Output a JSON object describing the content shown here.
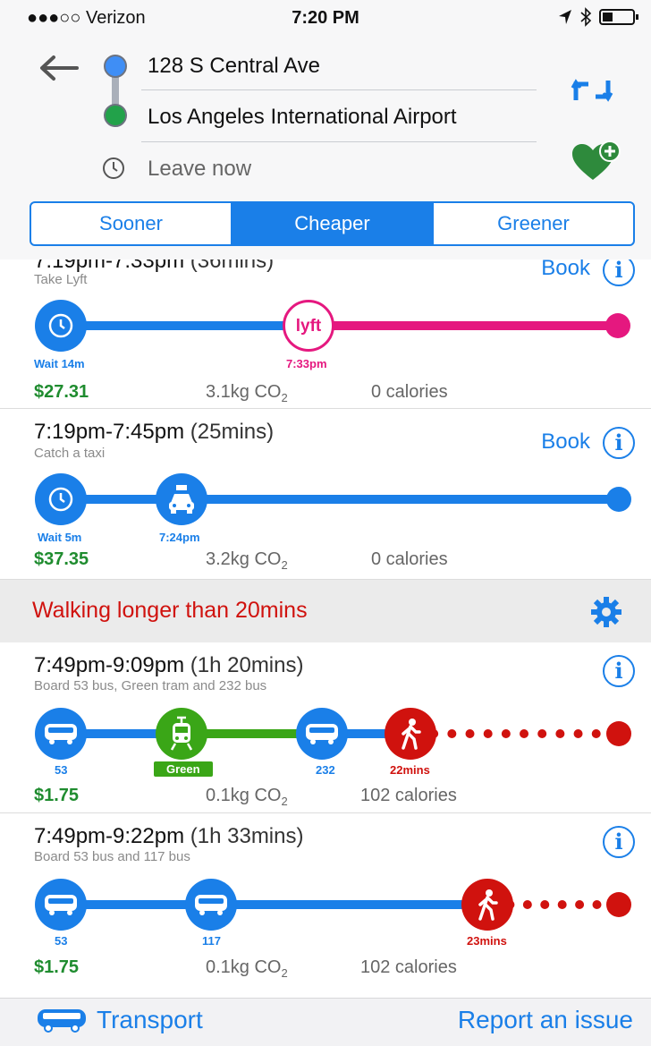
{
  "status_bar": {
    "carrier": "●●●○○ Verizon",
    "time": "7:20 PM",
    "battery_level": 0.35
  },
  "trip": {
    "from": "128 S Central Ave",
    "to": "Los Angeles International Airport",
    "leave": "Leave now"
  },
  "tabs": [
    "Sooner",
    "Cheaper",
    "Greener"
  ],
  "active_tab": "Cheaper",
  "results_top": [
    {
      "time": "7:19pm-7:33pm",
      "duration": "(36mins)",
      "subtitle": "Take Lyft",
      "book": "Book",
      "labels": [
        "Wait 14m",
        "7:33pm"
      ],
      "price": "$27.31",
      "co2": "3.1kg CO",
      "co2_sub": "2",
      "calories": "0 calories"
    },
    {
      "time": "7:19pm-7:45pm",
      "duration": "(25mins)",
      "subtitle": "Catch a taxi",
      "book": "Book",
      "labels": [
        "Wait 5m",
        "7:24pm"
      ],
      "price": "$37.35",
      "co2": "3.2kg CO",
      "co2_sub": "2",
      "calories": "0 calories"
    }
  ],
  "walk_banner": "Walking longer than 20mins",
  "results_bottom": [
    {
      "time": "7:49pm-9:09pm",
      "duration": "(1h 20mins)",
      "subtitle": "Board 53 bus, Green tram and 232 bus",
      "labels": [
        "53",
        "Green",
        "232",
        "22mins"
      ],
      "price": "$1.75",
      "co2": "0.1kg CO",
      "co2_sub": "2",
      "calories": "102 calories"
    },
    {
      "time": "7:49pm-9:22pm",
      "duration": "(1h 33mins)",
      "subtitle": "Board 53 bus and 117 bus",
      "labels": [
        "53",
        "117",
        "23mins"
      ],
      "price": "$1.75",
      "co2": "0.1kg CO",
      "co2_sub": "2",
      "calories": "102 calories"
    }
  ],
  "tab_bar": {
    "transport": "Transport",
    "report": "Report an issue"
  },
  "colors": {
    "blue": "#1a7fe8",
    "lyft": "#e5187f",
    "green": "#3aa617",
    "walk_red": "#d0120e",
    "price_green": "#1f8c2f"
  },
  "icons": [
    "back-arrow-icon",
    "swap-icon",
    "favorite-add-icon",
    "clock-icon",
    "lyft-logo",
    "taxi-icon",
    "bus-icon",
    "tram-icon",
    "walk-icon",
    "info-icon",
    "gear-icon"
  ]
}
